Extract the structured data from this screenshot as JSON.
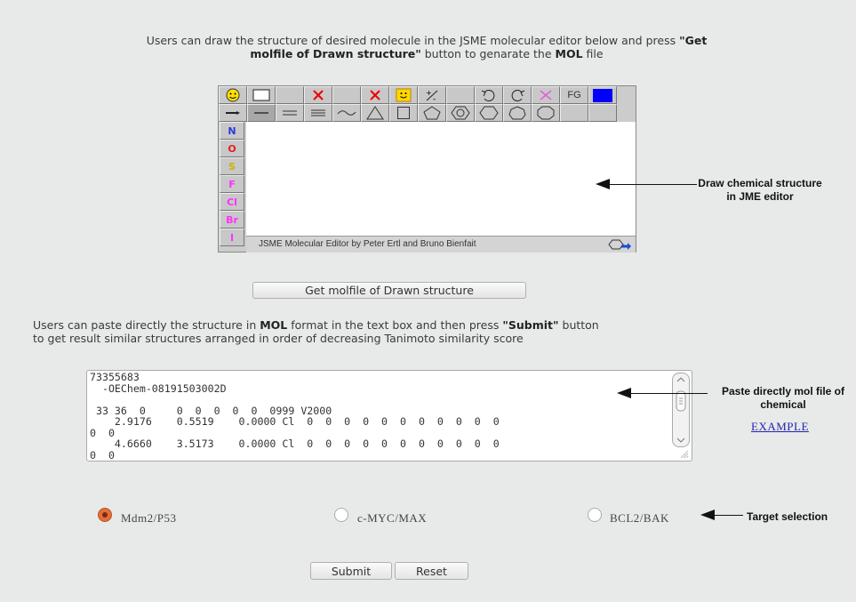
{
  "intro": {
    "line1_a": "Users can draw the structure of desired molecule in the JSME molecular editor below and press ",
    "line1_b": "\"Get",
    "line2_a": "molfile of Drawn structure\"",
    "line2_b": " button to genarate the ",
    "line2_c": "MOL",
    "line2_d": " file"
  },
  "jsme": {
    "toolbar_row1": [
      "smiley-icon",
      "rectangle-icon",
      "blank",
      "delete-x-icon",
      "blank",
      "delete-x-icon",
      "smiley-icon",
      "charge-icon",
      "blank",
      "undo-icon",
      "redo-icon",
      "clear-icon",
      "FG",
      "color-blue-icon"
    ],
    "fg_label": "FG",
    "toolbar_row2": [
      "chain-icon",
      "single-bond-icon",
      "double-bond-icon",
      "triple-bond-icon",
      "wavy-bond-icon",
      "triangle-ring-icon",
      "square-ring-icon",
      "pentagon-ring-icon",
      "benzene-ring-icon",
      "hexagon-ring-icon",
      "heptagon-ring-icon",
      "octagon-ring-icon",
      "blank",
      "blank"
    ],
    "elements": [
      {
        "symbol": "N",
        "color": "#2a3adc"
      },
      {
        "symbol": "O",
        "color": "#e02020"
      },
      {
        "symbol": "S",
        "color": "#c8b400"
      },
      {
        "symbol": "F",
        "color": "#ff30ff"
      },
      {
        "symbol": "Cl",
        "color": "#ff30ff"
      },
      {
        "symbol": "Br",
        "color": "#ff30ff"
      },
      {
        "symbol": "I",
        "color": "#ff30ff"
      }
    ],
    "status_text": "JSME Molecular Editor by Peter Ertl and Bruno Bienfait"
  },
  "annotations": {
    "draw_line1": "Draw chemical structure",
    "draw_line2": "in JME editor",
    "paste_line1": "Paste directly mol file of",
    "paste_line2": "chemical",
    "target": "Target selection"
  },
  "get_molfile_button": "Get molfile of Drawn structure",
  "mid": {
    "a": "Users can paste directly the structure in ",
    "b": "MOL",
    "c": " format in the text box and then press ",
    "d": "\"Submit\"",
    "e": " button",
    "line2": "to get result similar structures arranged in order of decreasing Tanimoto similarity score"
  },
  "molfile_text": "73355683\n  -OEChem-08191503002D\n\n 33 36  0     0  0  0  0  0  0999 V2000\n    2.9176    0.5519    0.0000 Cl  0  0  0  0  0  0  0  0  0  0  0\n0  0\n    4.6660    3.5173    0.0000 Cl  0  0  0  0  0  0  0  0  0  0  0\n0  0",
  "example_link": "EXAMPLE",
  "targets": [
    {
      "label": "Mdm2/P53",
      "selected": true
    },
    {
      "label": "c-MYC/MAX",
      "selected": false
    },
    {
      "label": "BCL2/BAK",
      "selected": false
    }
  ],
  "submit_label": "Submit",
  "reset_label": "Reset"
}
